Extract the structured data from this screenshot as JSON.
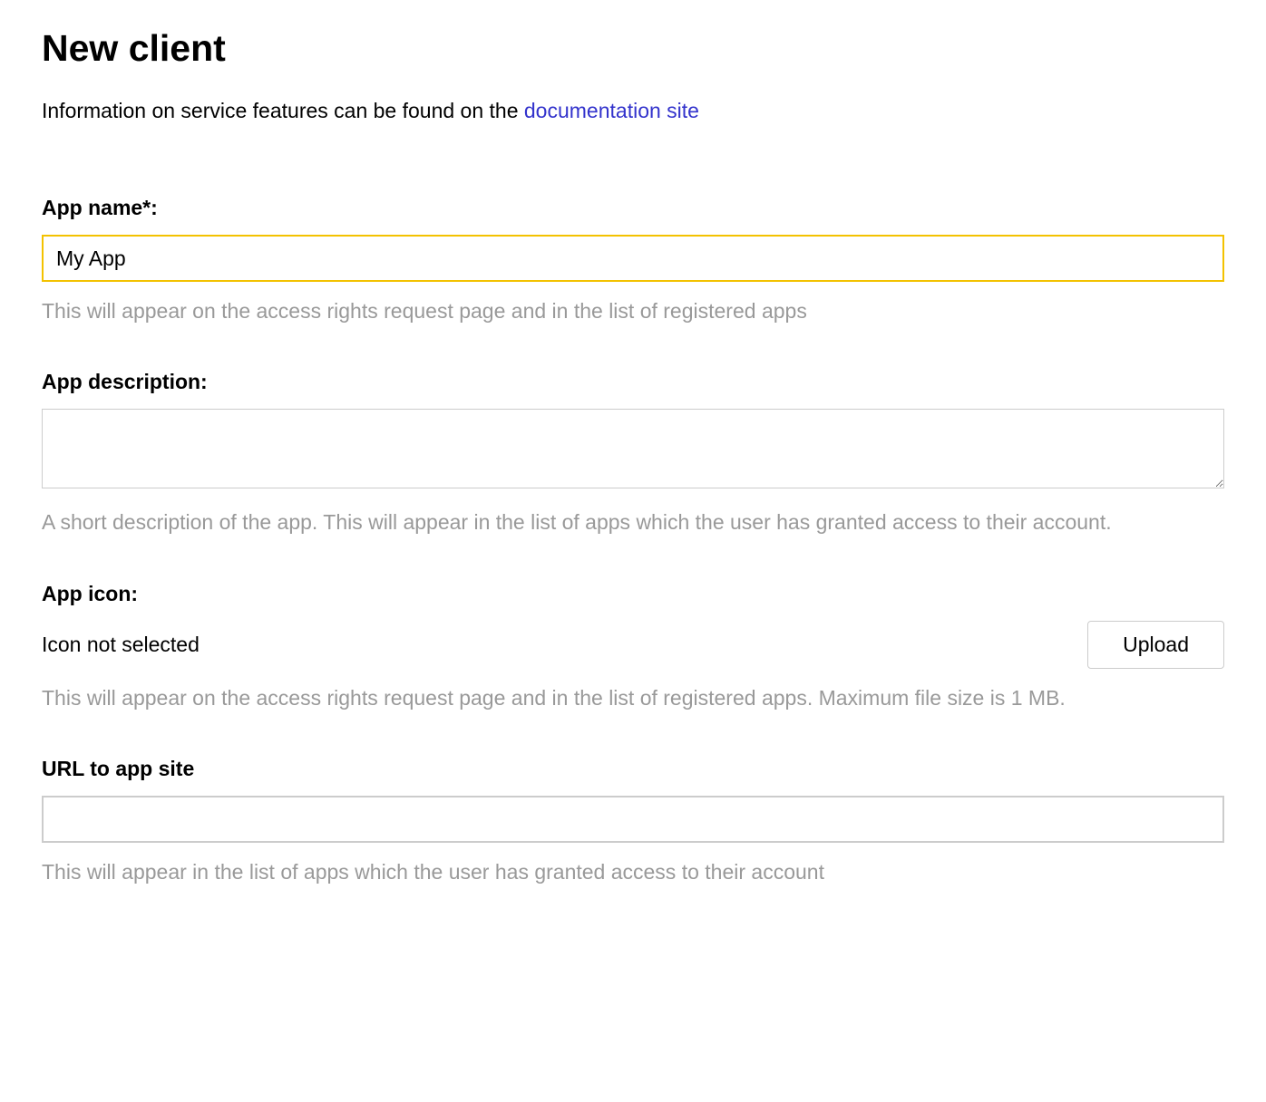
{
  "header": {
    "title": "New client",
    "info_prefix": "Information on service features can be found on the ",
    "info_link_text": "documentation site"
  },
  "form": {
    "app_name": {
      "label": "App name*:",
      "value": "My App",
      "help": "This will appear on the access rights request page and in the list of registered apps"
    },
    "app_description": {
      "label": "App description:",
      "value": "",
      "help": "A short description of the app. This will appear in the list of apps which the user has granted access to their account."
    },
    "app_icon": {
      "label": "App icon:",
      "status": "Icon not selected",
      "upload_label": "Upload",
      "help": "This will appear on the access rights request page and in the list of registered apps. Maximum file size is 1 MB."
    },
    "app_url": {
      "label": "URL to app site",
      "value": "",
      "help": "This will appear in the list of apps which the user has granted access to their account"
    }
  }
}
